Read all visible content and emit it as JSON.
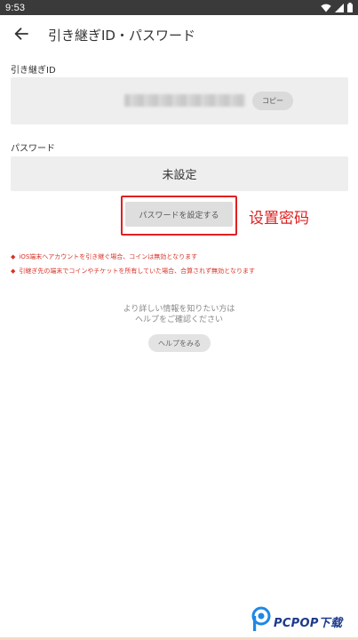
{
  "status_bar": {
    "time": "9:53",
    "icons": [
      "wifi-icon",
      "signal-icon",
      "battery-icon"
    ],
    "background": "#3a3a3a"
  },
  "app_bar": {
    "back_icon": "arrow-left-icon",
    "title": "引き継ぎID・パスワード"
  },
  "id_section": {
    "label": "引き継ぎID",
    "value": "",
    "copy_label": "コピー"
  },
  "password_section": {
    "label": "パスワード",
    "status": "未設定",
    "set_button_label": "パスワードを設定する",
    "annotation": "设置密码"
  },
  "warnings": [
    "iOS端末へアカウントを引き継ぐ場合、コインは無効となります",
    "引継ぎ先の端末でコインやチケットを所有していた場合、合算されず無効となります"
  ],
  "help": {
    "line1": "より詳しい情報を知りたい方は",
    "line2": "ヘルプをご確認ください",
    "button_label": "ヘルプをみる"
  },
  "watermark": {
    "text": "PCPOP下载"
  },
  "colors": {
    "accent_red": "#e02020",
    "warning_red": "#d93025",
    "panel_gray": "#eeeeee",
    "watermark_blue": "#1e3a8a"
  }
}
